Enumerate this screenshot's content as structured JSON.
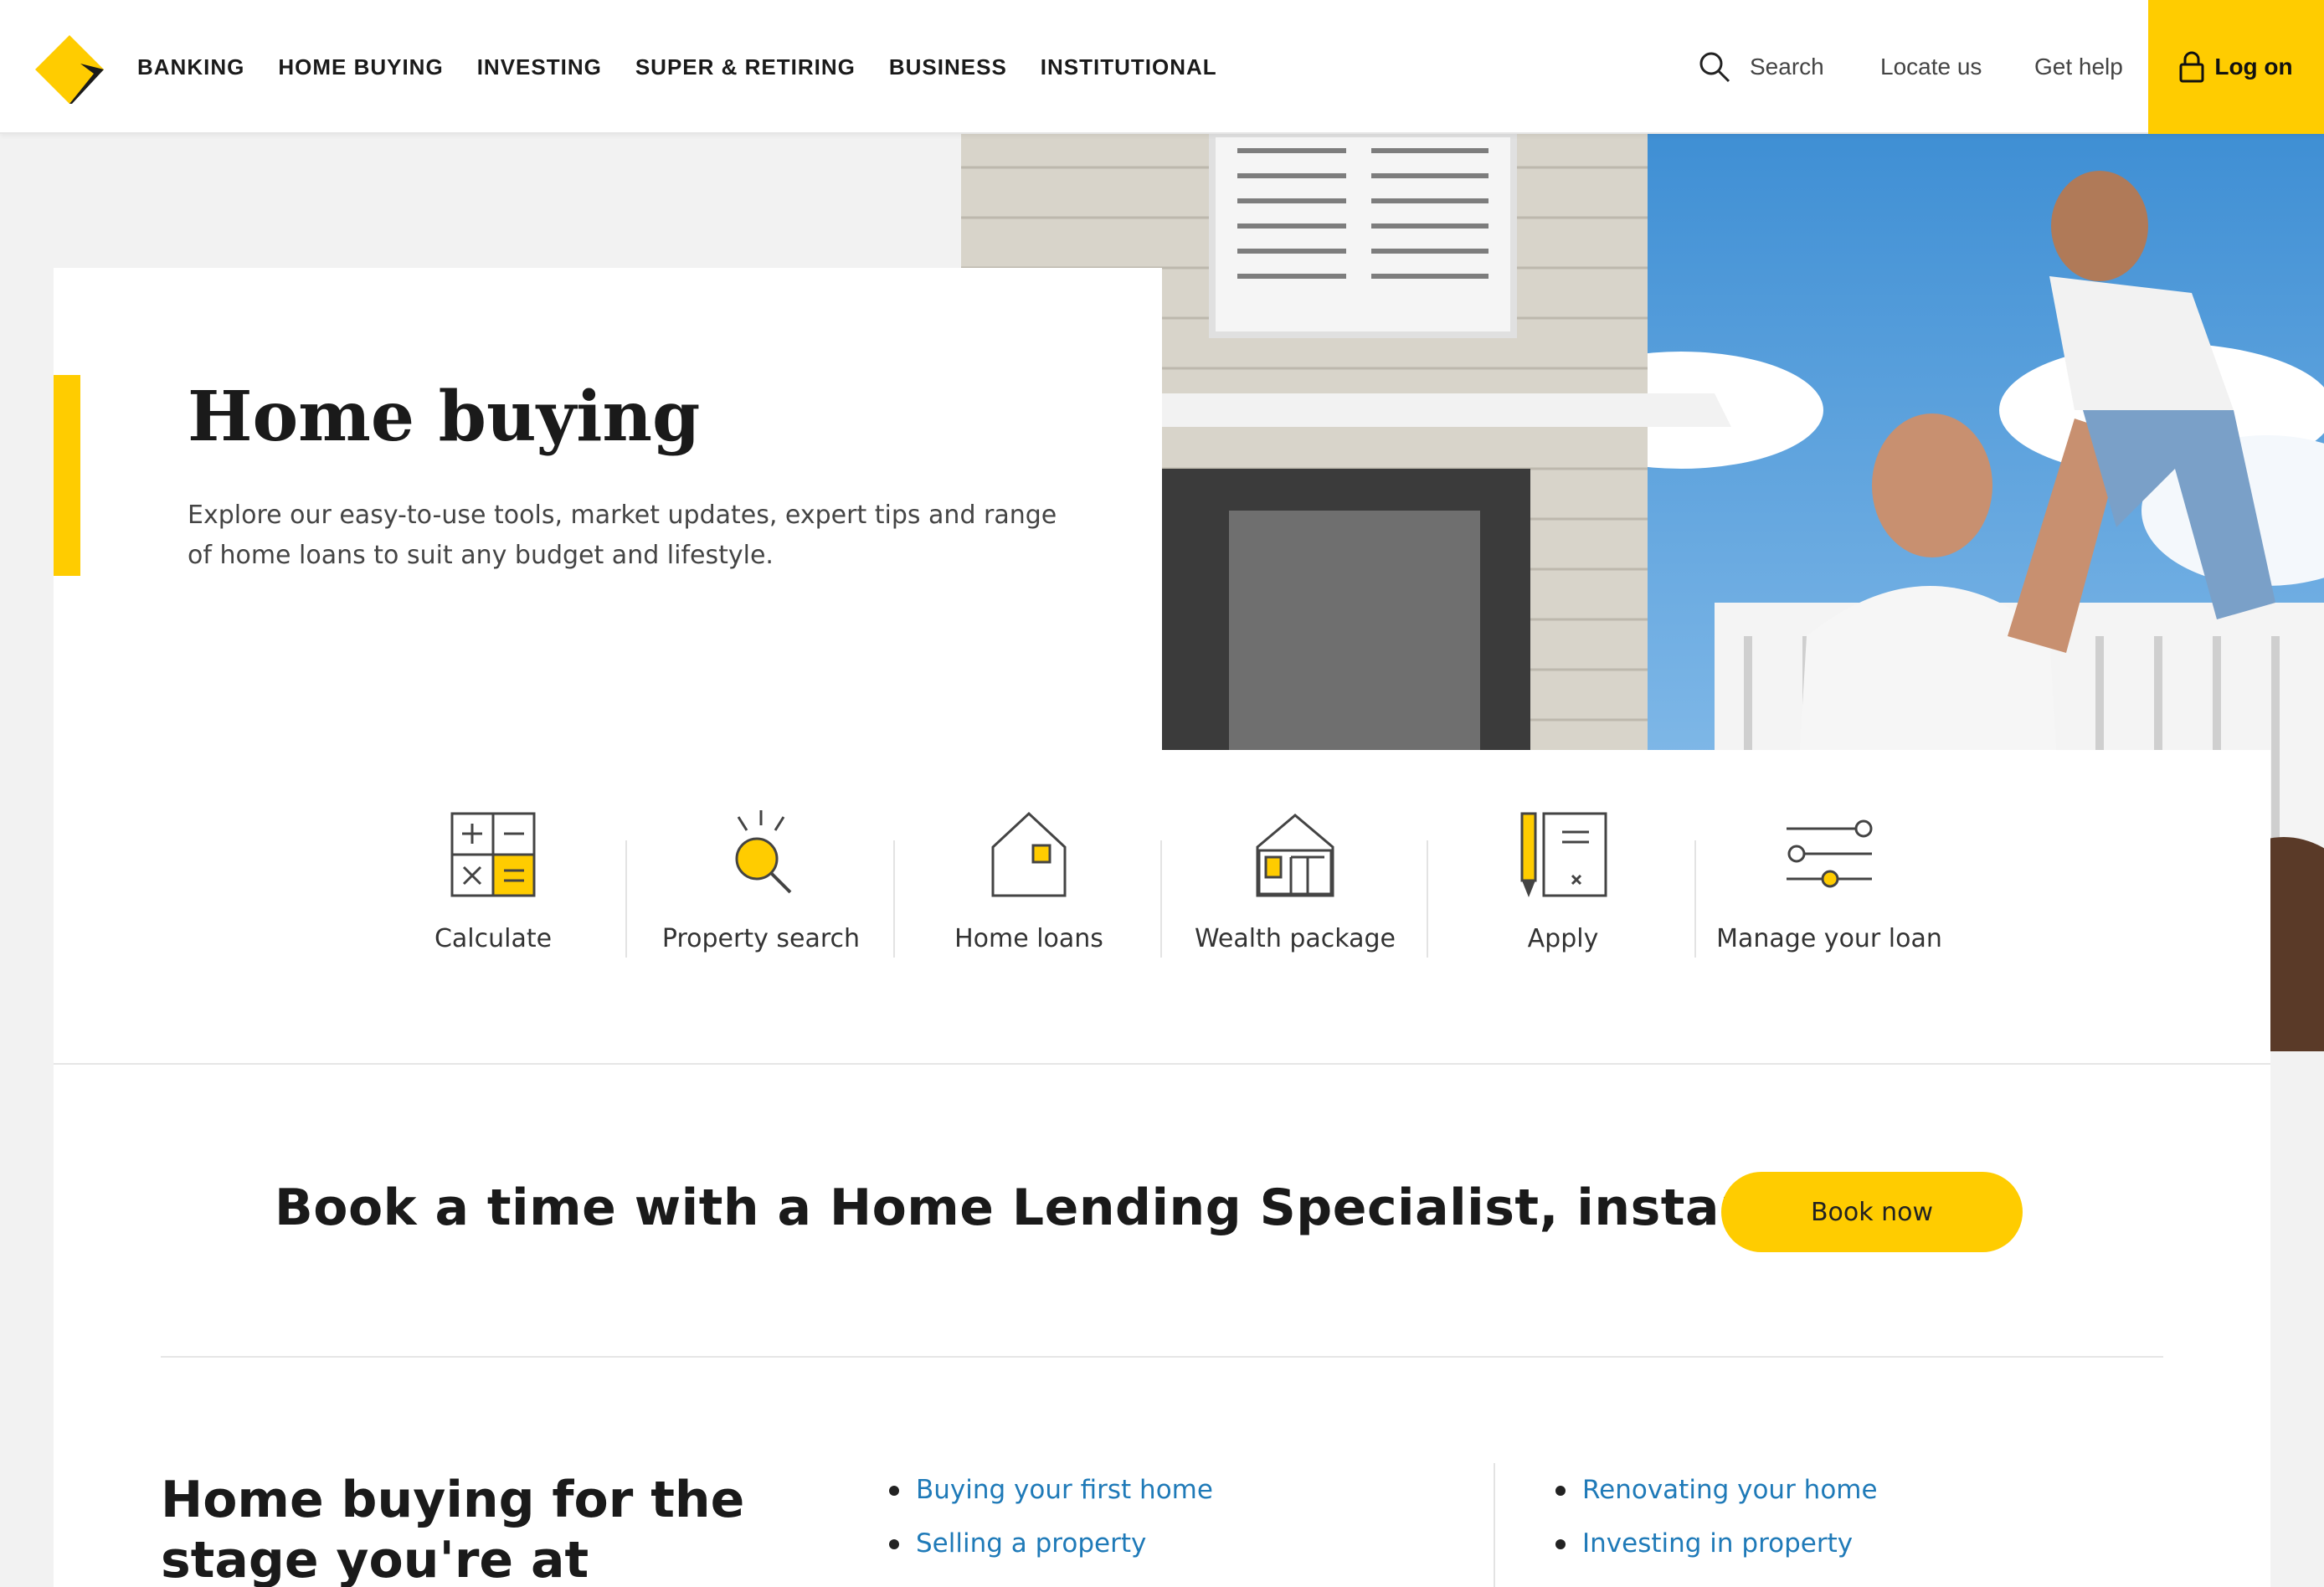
{
  "header": {
    "nav": [
      "BANKING",
      "HOME BUYING",
      "INVESTING",
      "SUPER & RETIRING",
      "BUSINESS",
      "INSTITUTIONAL"
    ],
    "search_label": "Search",
    "locate_label": "Locate us",
    "help_label": "Get help",
    "logon_label": "Log on"
  },
  "hero": {
    "title": "Home buying",
    "description": "Explore our easy-to-use tools, market updates, expert tips and range of home loans to suit any budget and lifestyle."
  },
  "tools": [
    {
      "label": "Calculate",
      "icon": "calculator-icon"
    },
    {
      "label": "Property search",
      "icon": "property-search-icon"
    },
    {
      "label": "Home loans",
      "icon": "house-icon"
    },
    {
      "label": "Wealth package",
      "icon": "wealth-package-icon"
    },
    {
      "label": "Apply",
      "icon": "apply-form-icon"
    },
    {
      "label": "Manage your loan",
      "icon": "sliders-icon"
    }
  ],
  "cta": {
    "text": "Book a time with a Home Lending Specialist, instantly",
    "button": "Book now"
  },
  "stages": {
    "title": "Home buying for the stage you're at",
    "col1": [
      "Buying your first home",
      "Selling a property"
    ],
    "col2": [
      "Renovating your home",
      "Investing in property"
    ]
  },
  "colors": {
    "brand_yellow": "#ffcc00",
    "link_blue": "#1f7ab8"
  }
}
